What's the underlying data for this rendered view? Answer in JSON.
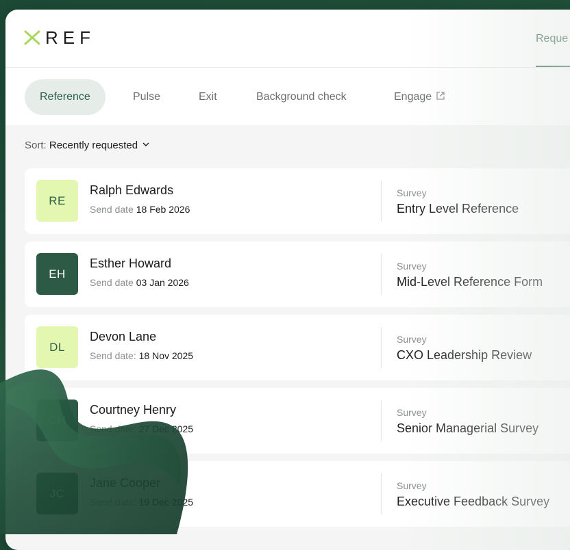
{
  "brand": {
    "name": "REF",
    "accent": "#a6d85b",
    "primary": "#2b5f46"
  },
  "top_nav": {
    "label": "Reque"
  },
  "tabs": [
    {
      "label": "Reference",
      "active": true
    },
    {
      "label": "Pulse",
      "active": false
    },
    {
      "label": "Exit",
      "active": false
    },
    {
      "label": "Background check",
      "active": false
    },
    {
      "label": "Engage",
      "active": false,
      "icon": "external-link-icon"
    }
  ],
  "sort": {
    "label": "Sort:",
    "value": "Recently requested",
    "icon": "chevron-down-icon"
  },
  "rows": [
    {
      "initials": "RE",
      "name": "Ralph Edwards",
      "send_label": "Send date",
      "send_date": "18 Feb 2026",
      "survey_label": "Survey",
      "survey": "Entry Level Reference",
      "avatar_bg": "#e4f7b0",
      "avatar_fg": "#2b5f46"
    },
    {
      "initials": "EH",
      "name": "Esther Howard",
      "send_label": "Send date",
      "send_date": "03 Jan 2026",
      "survey_label": "Survey",
      "survey": "Mid-Level Reference Form",
      "avatar_bg": "#2d5a44",
      "avatar_fg": "#ffffff"
    },
    {
      "initials": "DL",
      "name": "Devon Lane",
      "send_label": "Send date:",
      "send_date": "18 Nov 2025",
      "survey_label": "Survey",
      "survey": "CXO Leadership Review",
      "avatar_bg": "#e4f7b0",
      "avatar_fg": "#2b5f46"
    },
    {
      "initials": "CH",
      "name": "Courtney Henry",
      "send_label": "Send date:",
      "send_date": "27 Dec 2025",
      "survey_label": "Survey",
      "survey": "Senior Managerial Survey",
      "avatar_bg": "#2d5a44",
      "avatar_fg": "#ffffff"
    },
    {
      "initials": "JC",
      "name": "Jane Cooper",
      "send_label": "Send date:",
      "send_date": "19 Dec 2025",
      "survey_label": "Survey",
      "survey": "Executive Feedback Survey",
      "avatar_bg": "#2d5a44",
      "avatar_fg": "#ffffff"
    }
  ]
}
